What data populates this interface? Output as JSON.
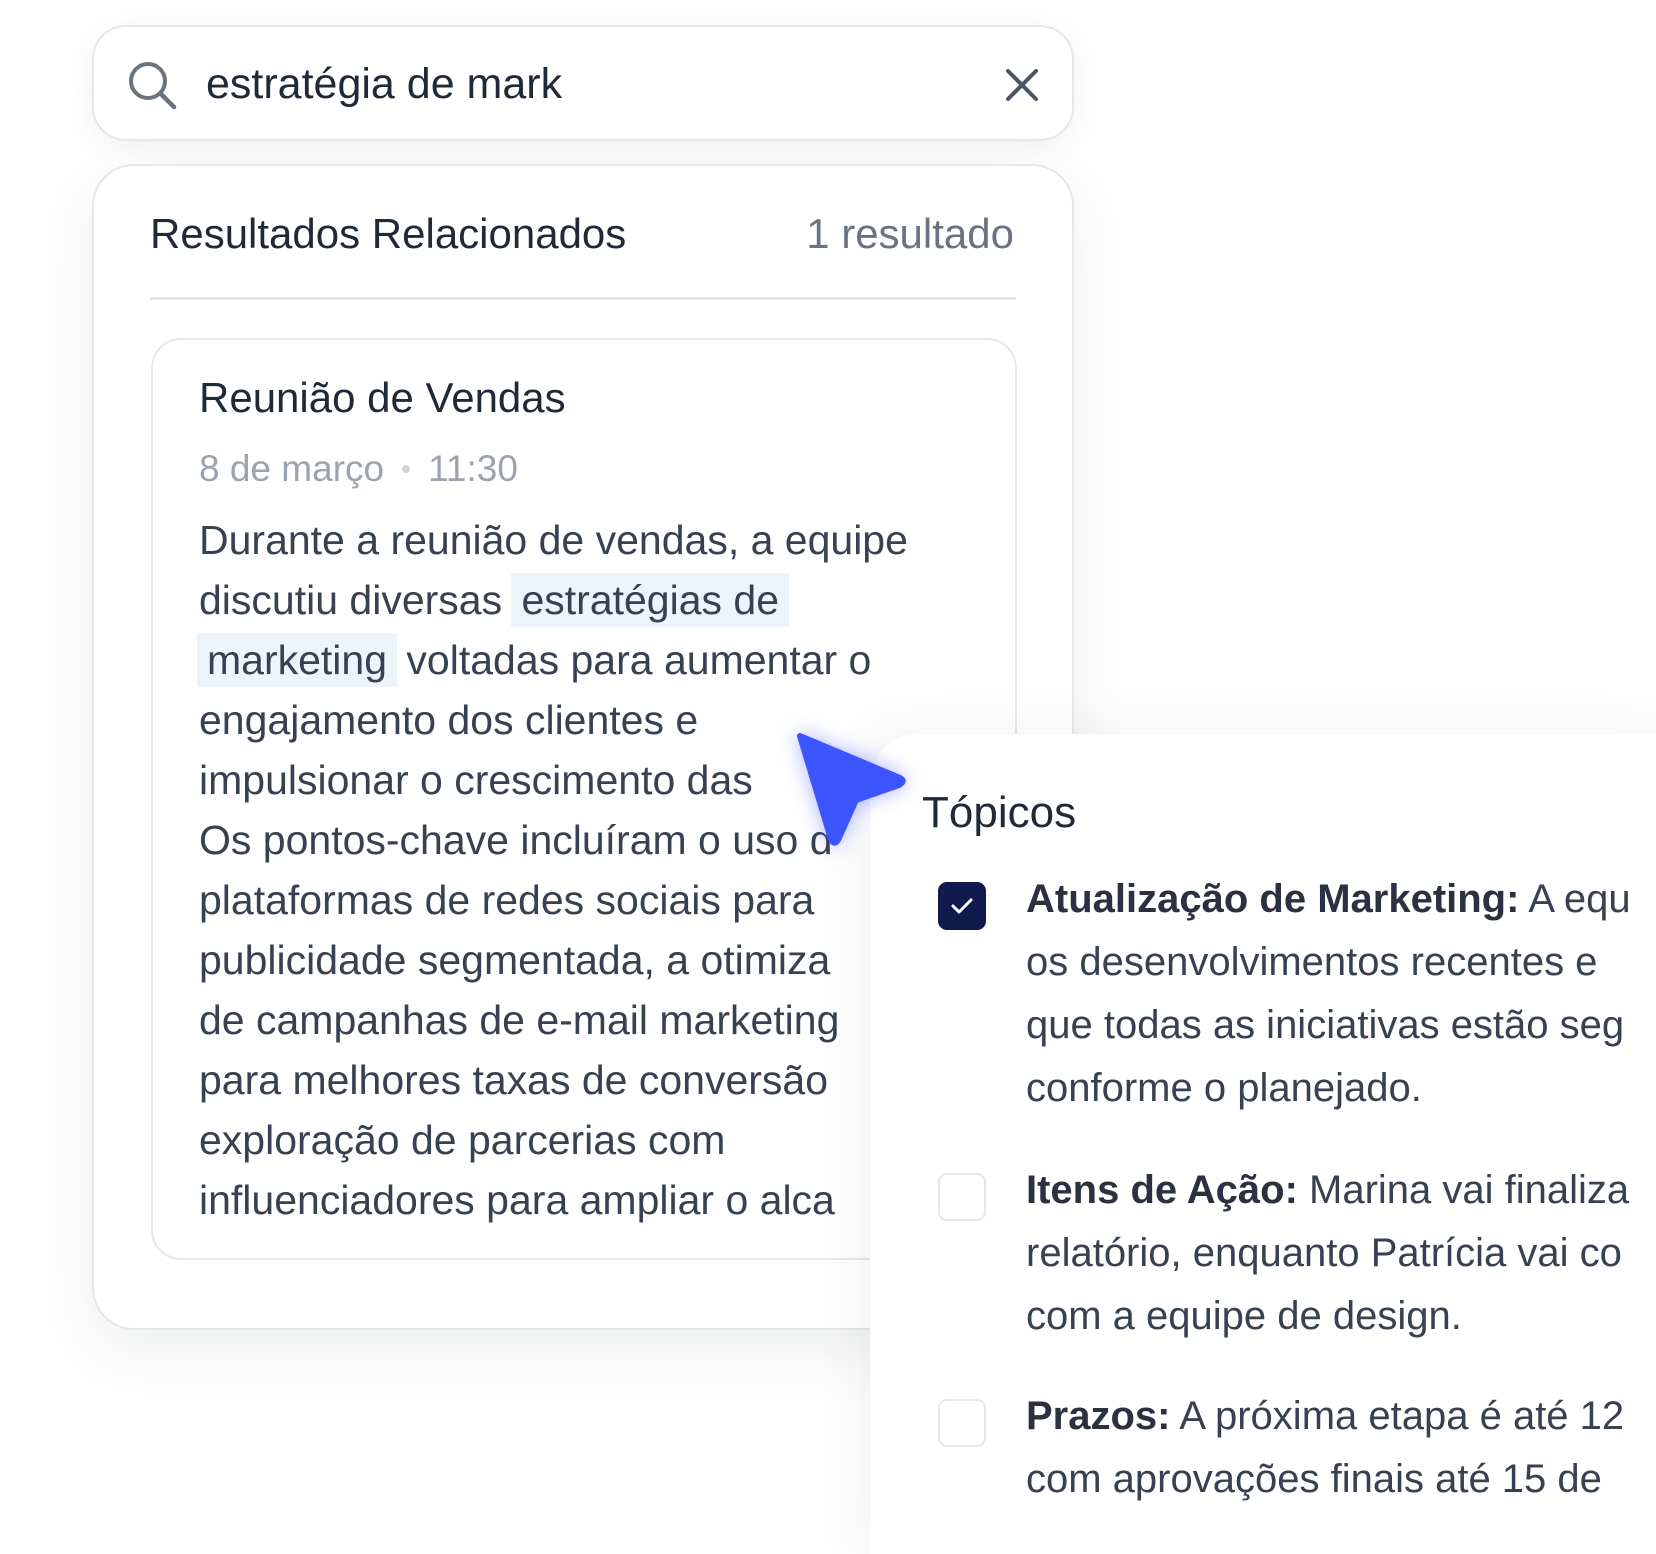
{
  "search": {
    "query": "estratégia de mark",
    "icon": "search-icon",
    "clear_icon": "close-icon"
  },
  "results": {
    "title": "Resultados Relacionados",
    "count": "1 resultado",
    "items": [
      {
        "title": "Reunião de Vendas",
        "date": "8 de março",
        "time": "11:30",
        "snippet": {
          "l1": "Durante a reunião de vendas, a equipe",
          "l2a": "discutiu diversas ",
          "l2hl": "estratégias de",
          "l3hl": "marketing",
          "l3b": " voltadas para aumentar o",
          "l4": "engajamento dos clientes e",
          "l5": "impulsionar o crescimento das",
          "l6": "Os pontos-chave incluíram o uso d",
          "l7": "plataformas de redes sociais para",
          "l8": "publicidade segmentada, a otimiza",
          "l9": "de campanhas de e-mail marketing",
          "l10": "para melhores taxas de conversão",
          "l11": "exploração de parcerias com",
          "l12": "influenciadores para ampliar o alca"
        }
      }
    ]
  },
  "topics": {
    "title": "Tópicos",
    "items": [
      {
        "checked": true,
        "label": "Atualização de Marketing:",
        "l1": " A equ",
        "l2": "os desenvolvimentos recentes e",
        "l3": "que todas as iniciativas estão seg",
        "l4": "conforme o planejado."
      },
      {
        "checked": false,
        "label": "Itens de Ação:",
        "l1": " Marina vai finaliza",
        "l2": "relatório, enquanto Patrícia vai co",
        "l3": "com a equipe de design."
      },
      {
        "checked": false,
        "label": "Prazos:",
        "l1": " A próxima etapa é até 12",
        "l2": "com aprovações finais até 15 de"
      }
    ]
  },
  "colors": {
    "highlight": "#eef4fb",
    "checkbox_checked": "#111a4d",
    "cursor": "#3d55ff"
  }
}
